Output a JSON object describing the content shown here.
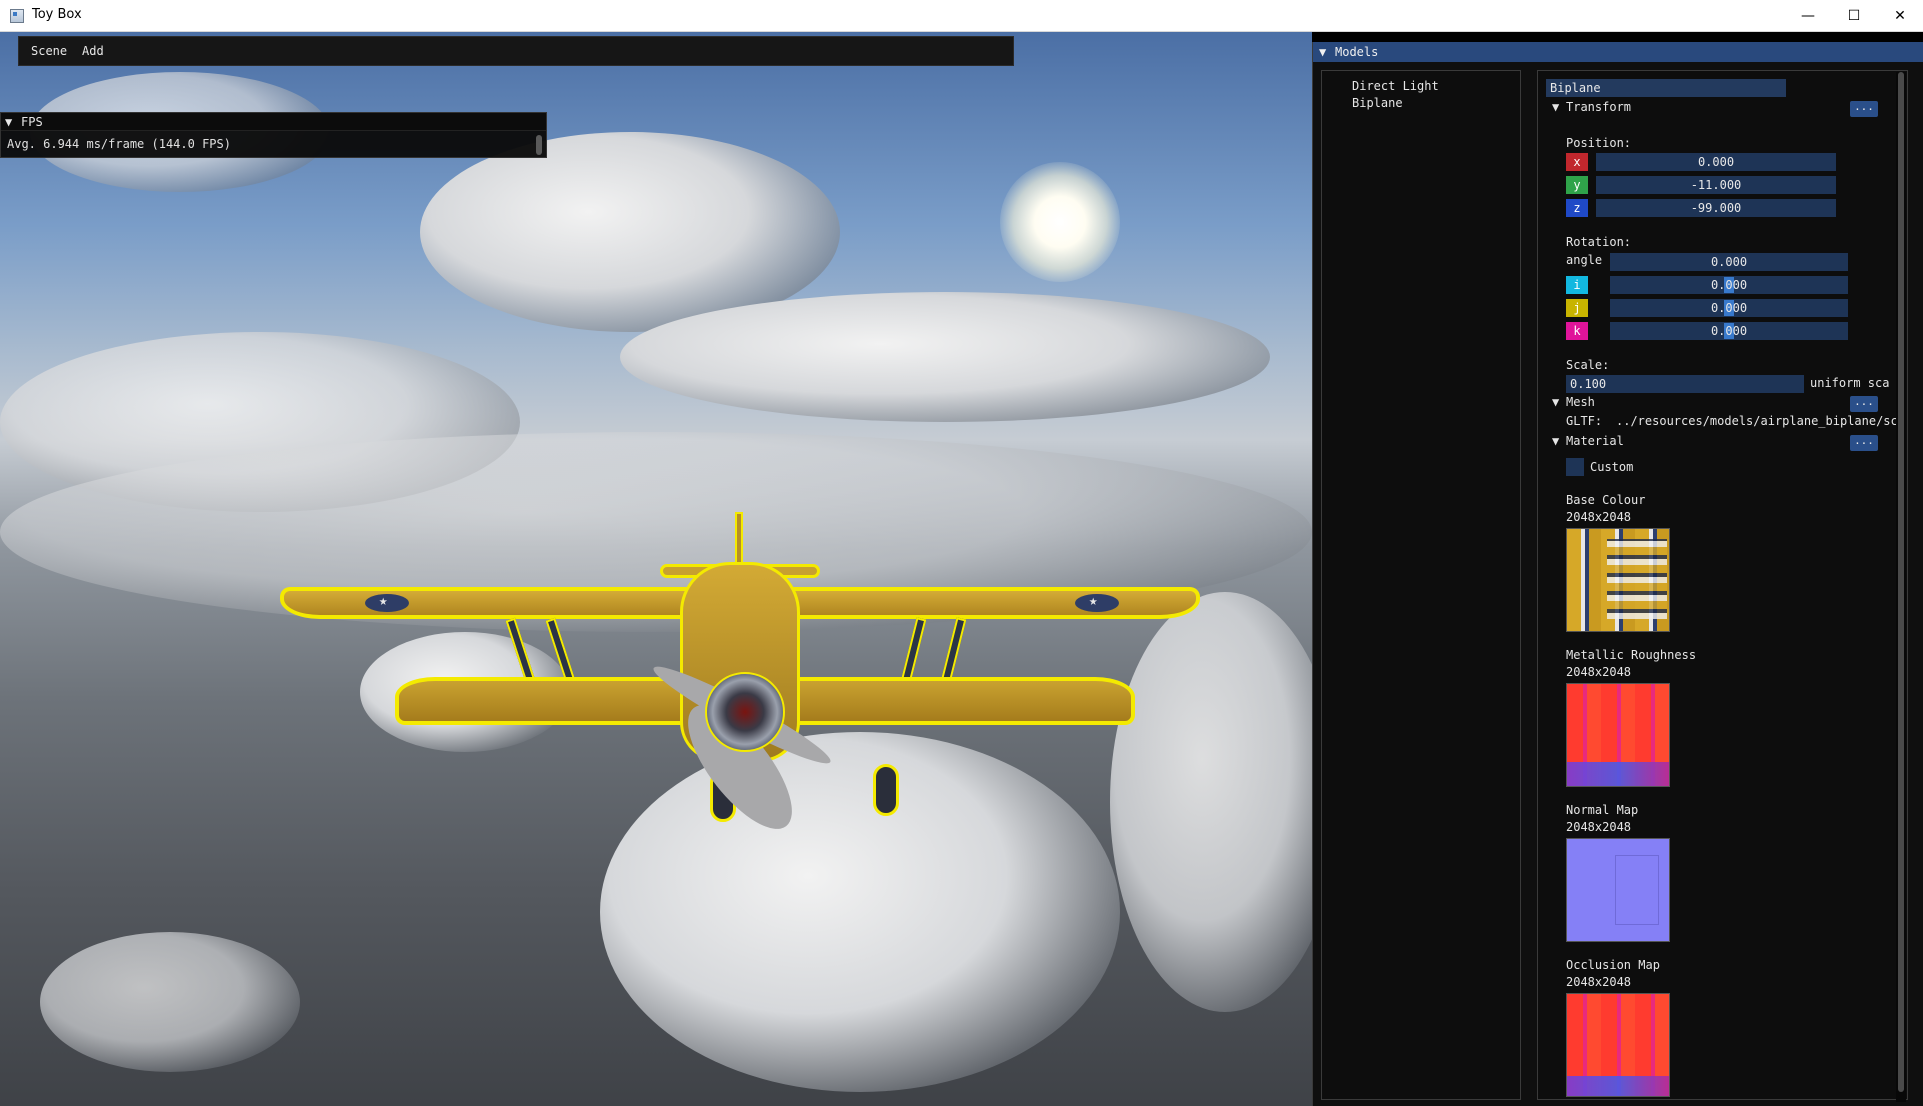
{
  "window": {
    "title": "Toy Box",
    "minimize": "—",
    "maximize": "☐",
    "close": "✕"
  },
  "menu": {
    "items": [
      "Scene",
      "Add"
    ]
  },
  "fps": {
    "title": "FPS",
    "text": "Avg. 6.944 ms/frame (144.0 FPS)"
  },
  "models": {
    "title": "Models",
    "list": [
      "Direct Light",
      "Biplane"
    ],
    "name_value": "Biplane",
    "transform": {
      "header": "Transform",
      "more": "...",
      "position_label": "Position:",
      "position": [
        {
          "axis": "x",
          "value": "0.000",
          "color": "#c1272d"
        },
        {
          "axis": "y",
          "value": "-11.000",
          "color": "#2fa34a"
        },
        {
          "axis": "z",
          "value": "-99.000",
          "color": "#1f49c7"
        }
      ],
      "rotation_label": "Rotation:",
      "angle_label": "angle",
      "angle_value": "0.000",
      "rotation": [
        {
          "axis": "i",
          "value": "0.000",
          "color": "#12b8e0"
        },
        {
          "axis": "j",
          "value": "0.000",
          "color": "#c8b400"
        },
        {
          "axis": "k",
          "value": "0.000",
          "color": "#e0149a"
        }
      ],
      "scale_label": "Scale:",
      "scale_value": "0.100",
      "uniform_label": "uniform sca"
    },
    "mesh": {
      "header": "Mesh",
      "more": "...",
      "gltf_label": "GLTF:",
      "gltf_path": "../resources/models/airplane_biplane/sc"
    },
    "material": {
      "header": "Material",
      "more": "...",
      "custom_label": "Custom",
      "textures": [
        {
          "name": "Base Colour",
          "size": "2048x2048"
        },
        {
          "name": "Metallic Roughness",
          "size": "2048x2048"
        },
        {
          "name": "Normal Map",
          "size": "2048x2048"
        },
        {
          "name": "Occlusion Map",
          "size": "2048x2048"
        }
      ]
    }
  }
}
